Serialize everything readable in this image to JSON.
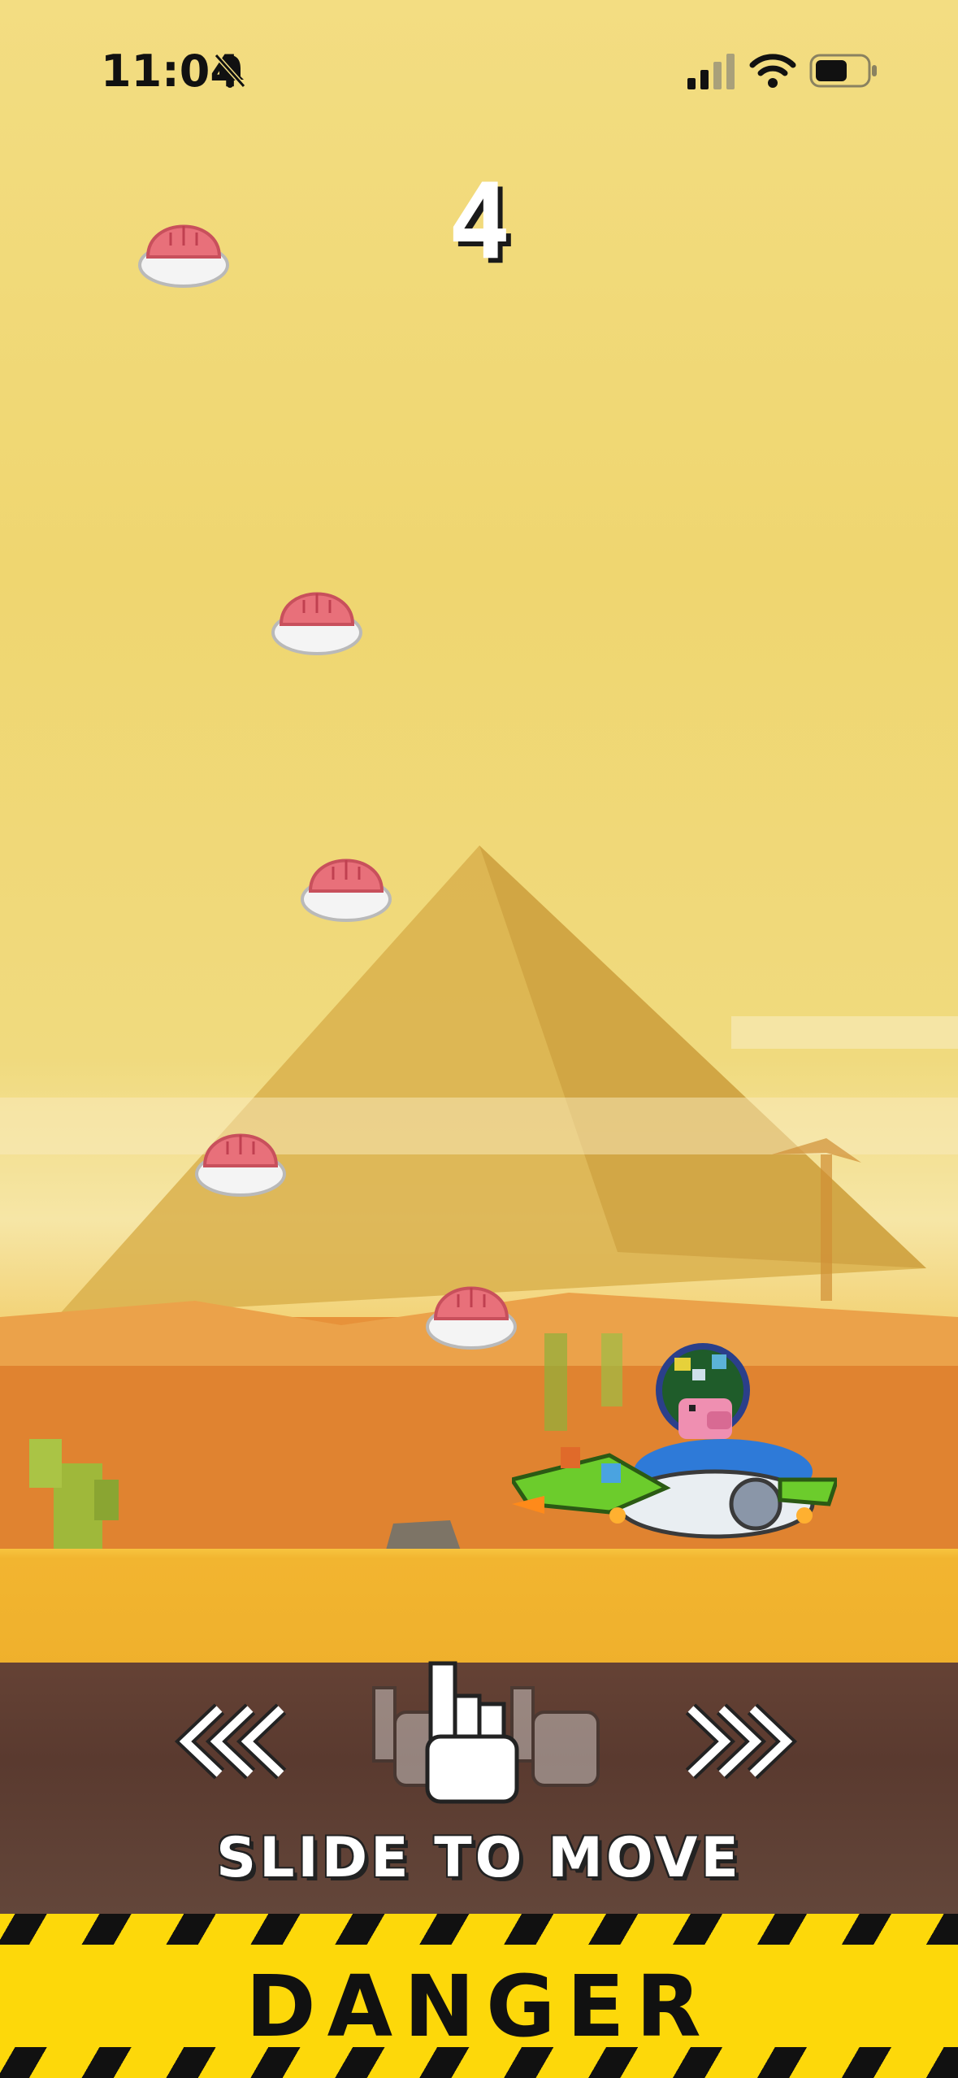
{
  "status_bar": {
    "time": "11:04"
  },
  "hud": {
    "score": "4"
  },
  "controls": {
    "hint": "SLIDE TO MOVE",
    "left_arrows": "left-arrows-icon",
    "right_arrows": "right-arrows-icon"
  },
  "banner": {
    "warning": "DANGER"
  },
  "game": {
    "enemies": [
      "pink-shell-icon",
      "pink-shell-icon",
      "pink-shell-icon",
      "pink-shell-icon",
      "pink-shell-icon"
    ],
    "player": "pig-pilot-spaceship"
  },
  "colors": {
    "sky": "#f0d970",
    "ground": "#f2b530",
    "dirt": "#5a3a2f",
    "danger_yellow": "#fdd80a",
    "shell_pink": "#e8707a"
  }
}
